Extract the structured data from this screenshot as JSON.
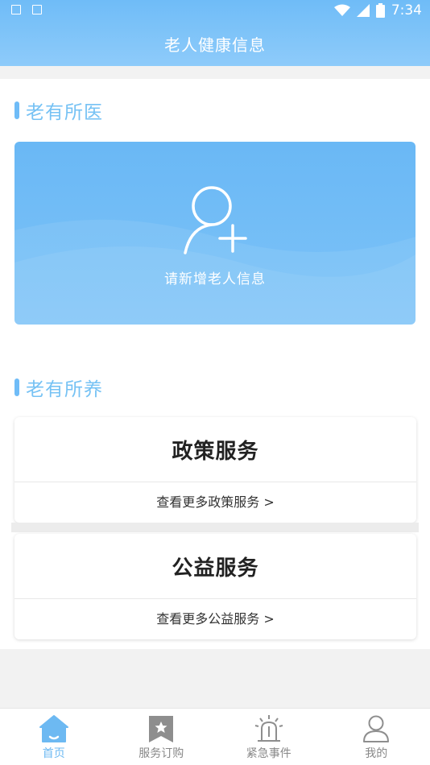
{
  "status_bar": {
    "time": "7:34"
  },
  "header": {
    "title": "老人健康信息"
  },
  "section_medical": {
    "title": "老有所医",
    "add_card": {
      "label": "请新增老人信息"
    }
  },
  "section_care": {
    "title": "老有所养",
    "cards": [
      {
        "name": "政策服务",
        "more": "查看更多政策服务 >"
      },
      {
        "name": "公益服务",
        "more": "查看更多公益服务 >"
      }
    ]
  },
  "bottom_nav": {
    "items": [
      {
        "label": "首页",
        "icon": "home-icon",
        "active": true
      },
      {
        "label": "服务订购",
        "icon": "bookmark-star-icon",
        "active": false
      },
      {
        "label": "紧急事件",
        "icon": "alarm-light-icon",
        "active": false
      },
      {
        "label": "我的",
        "icon": "person-icon",
        "active": false
      }
    ]
  },
  "colors": {
    "primary": "#6fbcf7",
    "active_nav": "#6db9f2",
    "section_title": "#76c2f4"
  }
}
